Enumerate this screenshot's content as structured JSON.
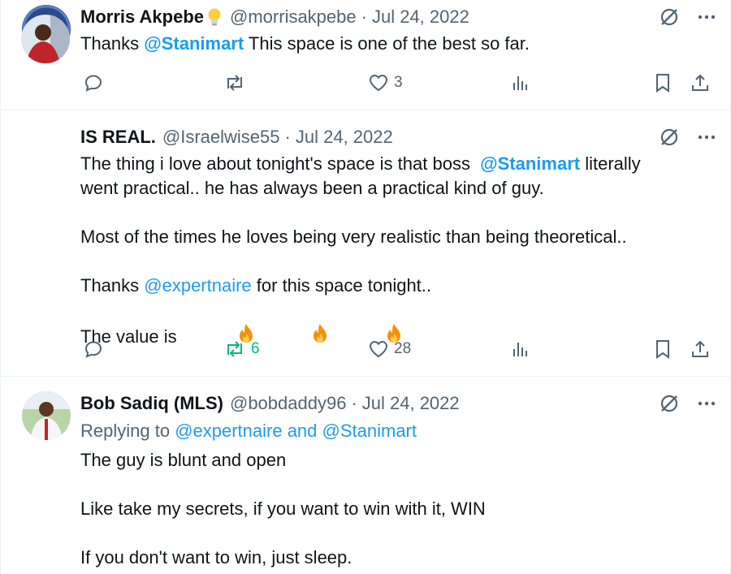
{
  "tweets": [
    {
      "name": "Morris Akpebe",
      "name_icon": "lightbulb-icon",
      "handle": "@morrisakpebe",
      "date": "Jul 24, 2022",
      "text_before": "Thanks ",
      "mention": "@Stanimart",
      "text_after": " This space is one of the best so far.",
      "likes": "3"
    },
    {
      "name": "IS REAL.",
      "handle": "@Israelwise55",
      "date": "Jul 24, 2022",
      "line1_before": "The thing i love about tonight's space is that boss  ",
      "line1_mention": "@Stanimart",
      "line1_after": " literally",
      "line2": "went practical.. he has always been a practical kind of guy.",
      "line3": "Most of the times he loves being very realistic than being theoretical..",
      "line4_before": "Thanks ",
      "line4_mention": "@expertnaire",
      "line4_after": " for this space tonight..",
      "line5": "The value is ",
      "reposts": "6",
      "likes": "28"
    },
    {
      "name": "Bob Sadiq (MLS)",
      "handle": "@bobdaddy96",
      "date": "Jul 24, 2022",
      "replying_prefix": "Replying to ",
      "replying_to": "@expertnaire and @Stanimart",
      "line1": "The guy is blunt and open",
      "line2": "Like take my secrets, if you want to win with it, WIN",
      "line3": "If you don't want to win, just sleep."
    }
  ],
  "separator": "·",
  "icons": {
    "grok": "grok-icon",
    "more": "more-icon",
    "reply": "reply-icon",
    "repost": "repost-icon",
    "like": "heart-icon",
    "views": "views-icon",
    "bookmark": "bookmark-icon",
    "share": "share-icon",
    "fire": "fire-icon"
  },
  "colors": {
    "accent": "#1d9bf0",
    "muted": "#536471",
    "text": "#0f1419",
    "repost_active": "#00ba7c",
    "divider": "#eff3f4"
  }
}
